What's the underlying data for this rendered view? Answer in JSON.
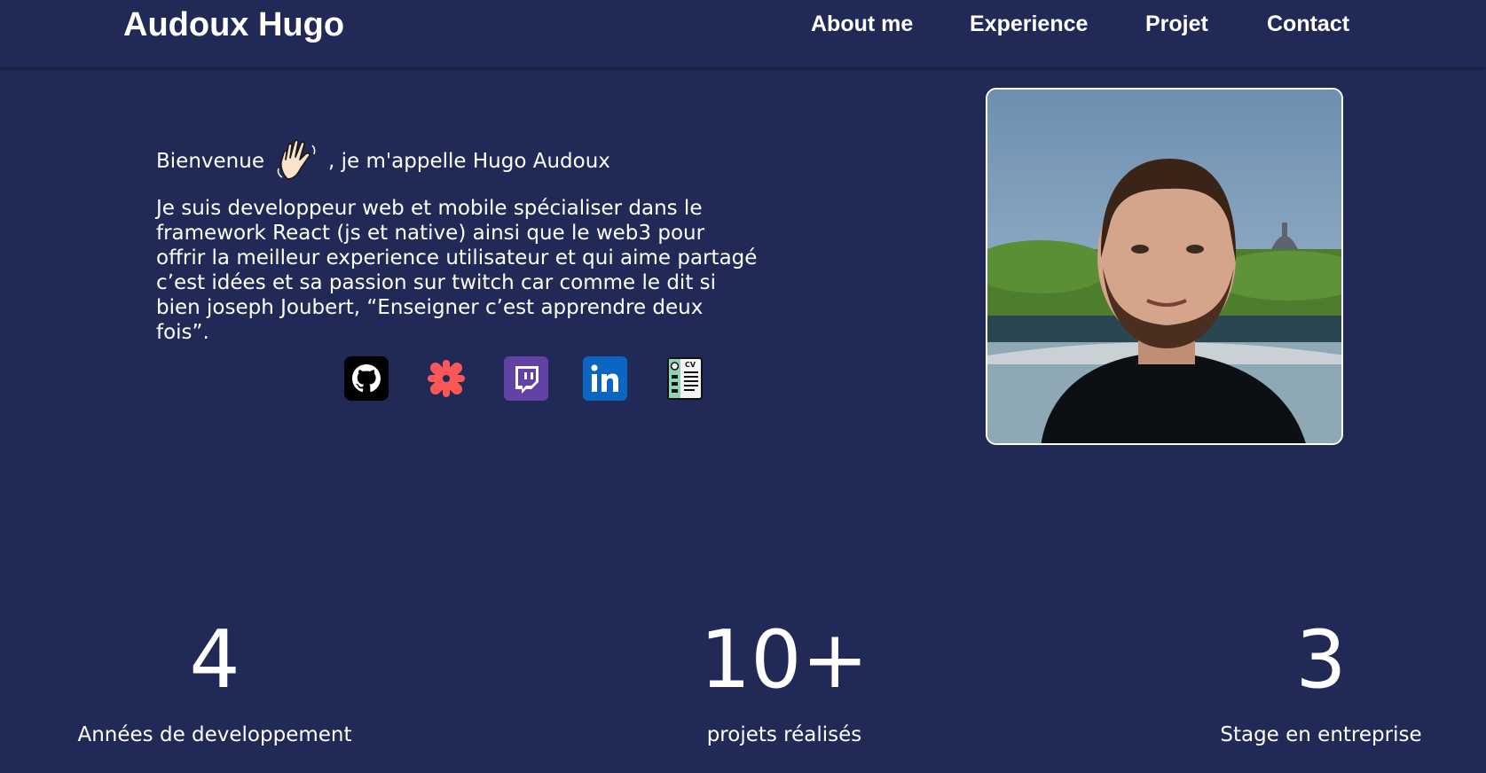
{
  "header": {
    "brand": "Audoux Hugo",
    "nav": [
      "About me",
      "Experience",
      "Projet",
      "Contact"
    ]
  },
  "intro": {
    "greeting_before": "Bienvenue",
    "greeting_after": ", je m'appelle Hugo Audoux",
    "bio_lines": [
      "Je suis developpeur web et mobile spécialiser dans le",
      "framework React (js et native) ainsi que le web3 pour",
      "offrir la meilleur experience utilisateur et qui aime partagé",
      "c’est idées et sa passion sur twitch car comme le dit si",
      "bien joseph Joubert, “Enseigner c’est apprendre deux fois”."
    ]
  },
  "socials": [
    {
      "icon": "github-icon",
      "color": "#000000"
    },
    {
      "icon": "malt-icon",
      "color": "#fc5757"
    },
    {
      "icon": "twitch-icon",
      "color": "#6441a5"
    },
    {
      "icon": "linkedin-icon",
      "color": "#0a66c2"
    },
    {
      "icon": "cv-icon",
      "color": "#1e1e1e"
    }
  ],
  "stats": [
    {
      "value": "4",
      "label": "Années de developpement"
    },
    {
      "value": "10+",
      "label": "projets réalisés"
    },
    {
      "value": "3",
      "label": "Stage en entreprise"
    }
  ],
  "colors": {
    "background": "#212957",
    "text": "#ffffff"
  }
}
